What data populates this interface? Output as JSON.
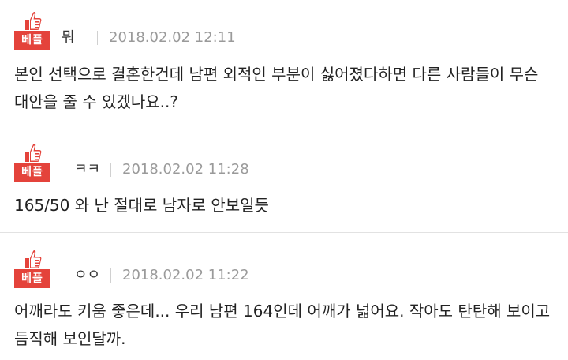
{
  "comments": [
    {
      "badge": "베플",
      "author": "뭐",
      "timestamp": "2018.02.02 12:11",
      "text": "본인 선택으로 결혼한건데 남편 외적인 부분이 싫어졌다하면 다른 사람들이 무슨\n대안을 줄 수 있겠나요..?"
    },
    {
      "badge": "베플",
      "author": "ㅋㅋ",
      "timestamp": "2018.02.02 11:28",
      "text": "165/50 와 난 절대로 남자로 안보일듯"
    },
    {
      "badge": "베플",
      "author": "ㅇㅇ",
      "timestamp": "2018.02.02 11:22",
      "text": "어깨라도 키움 좋은데... 우리 남편 164인데 어깨가 넓어요. 작아도 탄탄해 보이고\n듬직해 보인달까."
    }
  ],
  "colors": {
    "badge_red": "#e4433b",
    "timestamp_gray": "#9a9a9a",
    "divider": "#e2e2e2"
  }
}
